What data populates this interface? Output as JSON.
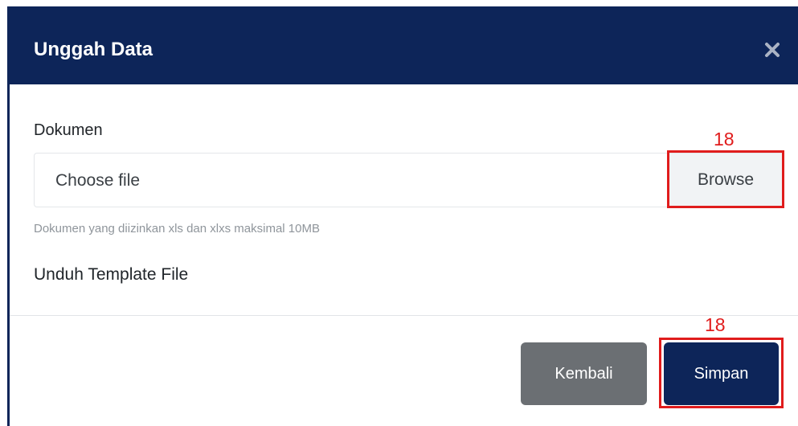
{
  "modal": {
    "title": "Unggah Data",
    "close_icon": "close-icon"
  },
  "form": {
    "label": "Dokumen",
    "file_placeholder": "Choose file",
    "browse_label": "Browse",
    "help_text": "Dokumen yang diizinkan xls dan xlxs maksimal 10MB",
    "template_link": "Unduh Template File"
  },
  "annotations": {
    "browse_number": "18",
    "simpan_number": "18"
  },
  "footer": {
    "cancel_label": "Kembali",
    "save_label": "Simpan"
  },
  "colors": {
    "header": "#0d2559",
    "annotation": "#e01c1c",
    "cancel_button": "#6b6f73",
    "save_button": "#0d2559"
  }
}
